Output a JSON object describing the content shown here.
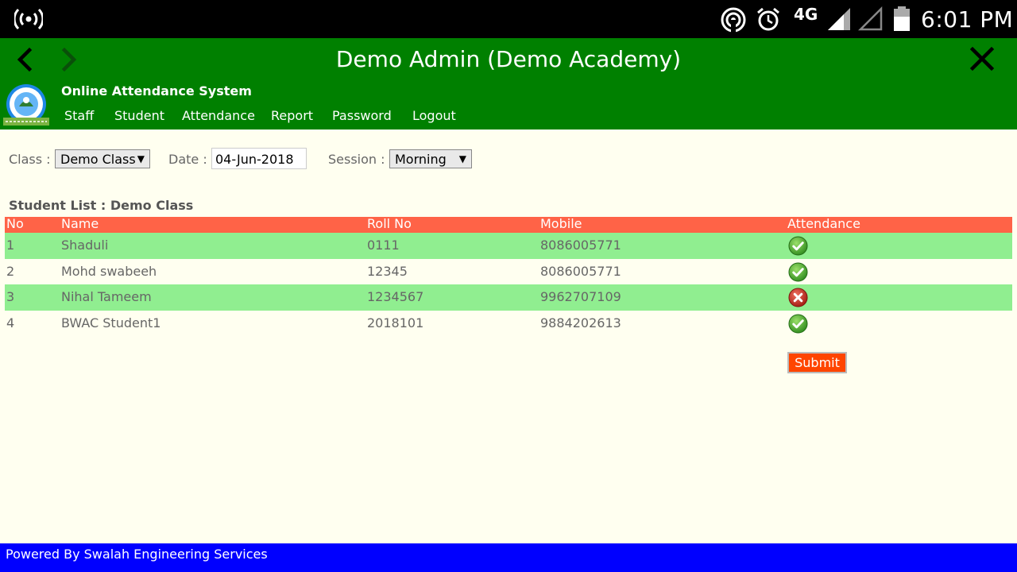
{
  "status_bar": {
    "time": "6:01 PM",
    "network": "4G",
    "icons": [
      "hotspot-icon",
      "nfc-icon",
      "alarm-icon",
      "signal-icon",
      "signal-empty-icon",
      "battery-icon"
    ]
  },
  "app_bar": {
    "title": "Demo Admin (Demo Academy)",
    "back_icon": "chevron-left-icon",
    "forward_icon": "chevron-right-icon",
    "close_icon": "close-icon"
  },
  "header": {
    "site_name": "Online Attendance System",
    "menu": [
      "Staff",
      "Student",
      "Attendance",
      "Report",
      "Password",
      "Logout"
    ]
  },
  "filters": {
    "class_label": "Class :",
    "class_value": "Demo Class",
    "date_label": "Date :",
    "date_value": "04-Jun-2018",
    "session_label": "Session :",
    "session_value": "Morning"
  },
  "student_list": {
    "title": "Student List : Demo Class",
    "columns": [
      "No",
      "Name",
      "Roll No",
      "Mobile",
      "Attendance"
    ],
    "rows": [
      {
        "no": "1",
        "name": "Shaduli",
        "roll": "0111",
        "mobile": "8086005771",
        "present": true
      },
      {
        "no": "2",
        "name": "Mohd swabeeh",
        "roll": "12345",
        "mobile": "8086005771",
        "present": true
      },
      {
        "no": "3",
        "name": "Nihal Tameem",
        "roll": "1234567",
        "mobile": "9962707109",
        "present": false
      },
      {
        "no": "4",
        "name": "BWAC Student1",
        "roll": "2018101",
        "mobile": "9884202613",
        "present": true
      }
    ]
  },
  "submit_label": "Submit",
  "footer": {
    "text": "Powered By Swalah Engineering Services"
  },
  "colors": {
    "header_green": "#008000",
    "table_header": "#ff6347",
    "row_alt": "#90ee90",
    "submit": "#ff4500",
    "footer_blue": "#0000ff",
    "background": "#fffff0"
  }
}
